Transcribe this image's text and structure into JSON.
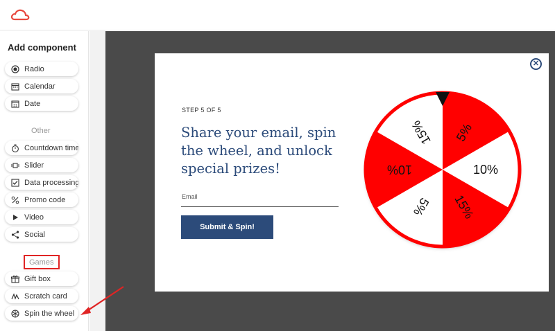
{
  "app": {
    "logo_icon": "cloud-logo-icon",
    "brand_color": "#e8483f"
  },
  "sidebar": {
    "title": "Add component",
    "items_top": [
      {
        "label": "Radio",
        "icon": "radio-icon"
      },
      {
        "label": "Calendar",
        "icon": "calendar-icon"
      },
      {
        "label": "Date",
        "icon": "date-icon"
      }
    ],
    "other_label": "Other",
    "items_other": [
      {
        "label": "Countdown timer",
        "icon": "timer-icon"
      },
      {
        "label": "Slider",
        "icon": "slider-icon"
      },
      {
        "label": "Data processing",
        "icon": "checkbox-icon"
      },
      {
        "label": "Promo code",
        "icon": "percent-icon"
      },
      {
        "label": "Video",
        "icon": "play-icon"
      },
      {
        "label": "Social",
        "icon": "share-icon"
      }
    ],
    "games_label": "Games",
    "items_games": [
      {
        "label": "Gift box",
        "icon": "gift-icon"
      },
      {
        "label": "Scratch card",
        "icon": "scratch-icon"
      },
      {
        "label": "Spin the wheel",
        "icon": "wheel-icon"
      }
    ]
  },
  "popup": {
    "step": "STEP 5 OF 5",
    "headline": "Share your email, spin the wheel, and unlock special prizes!",
    "email_label": "Email",
    "submit_label": "Submit & Spin!",
    "close_symbol": "✕",
    "accent_color": "#2c4b7a",
    "wheel_color": "#ff0000",
    "wheel_segments": [
      "5%",
      "10%",
      "15%",
      "5%",
      "10%",
      "15%"
    ]
  }
}
